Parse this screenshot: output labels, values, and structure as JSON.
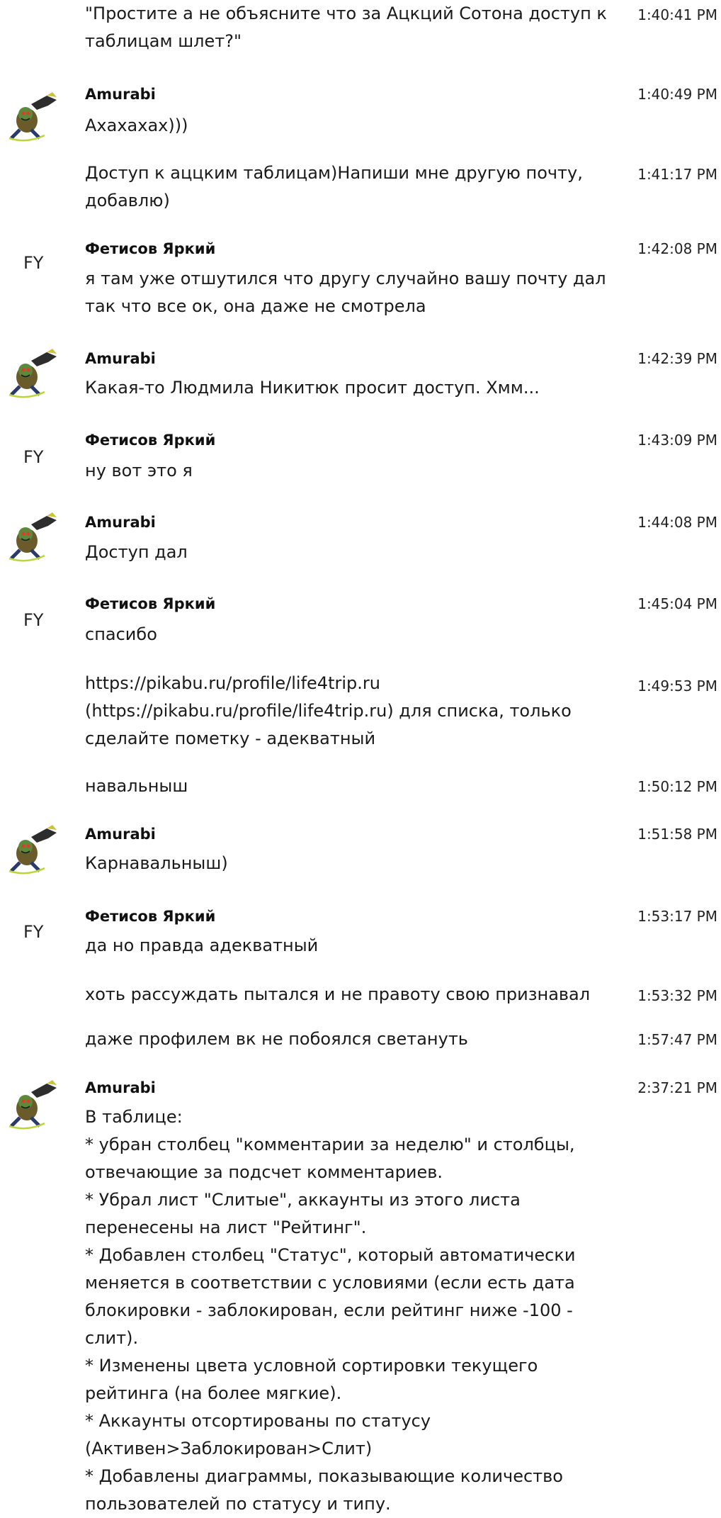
{
  "messages": [
    {
      "kind": "cont",
      "text": "\"Простите а не объясните что за Ацкций Сотона доступ к таблицам шлет?\"",
      "time": "1:40:41 PM"
    },
    {
      "kind": "head",
      "author": "Amurabi",
      "avatar": "goblin-avatar-icon",
      "text": "Ахахахах)))",
      "time": "1:40:49 PM"
    },
    {
      "kind": "cont",
      "text": "Доступ к аццким таблицам)Напиши мне другую почту, добавлю)",
      "time": "1:41:17 PM"
    },
    {
      "kind": "head",
      "author": "Фетисов Яркий",
      "initials": "FY",
      "text": "я там уже отшутился что другу случайно вашу почту дал так что все ок, она даже не смотрела",
      "time": "1:42:08 PM"
    },
    {
      "kind": "head",
      "author": "Amurabi",
      "avatar": "goblin-avatar-icon",
      "text": "Какая-то Людмила Никитюк просит доступ. Хмм...",
      "time": "1:42:39 PM"
    },
    {
      "kind": "head",
      "author": "Фетисов Яркий",
      "initials": "FY",
      "text": "ну вот это я",
      "time": "1:43:09 PM"
    },
    {
      "kind": "head",
      "author": "Amurabi",
      "avatar": "goblin-avatar-icon",
      "text": "Доступ дал",
      "time": "1:44:08 PM"
    },
    {
      "kind": "head",
      "author": "Фетисов Яркий",
      "initials": "FY",
      "text": "спасибо",
      "time": "1:45:04 PM"
    },
    {
      "kind": "cont",
      "text": "https://pikabu.ru/profile/life4trip.ru (https://pikabu.ru/profile/life4trip.ru) для списка, только сделайте пометку - адекватный",
      "time": "1:49:53 PM"
    },
    {
      "kind": "cont",
      "text": "навальныш",
      "time": "1:50:12 PM"
    },
    {
      "kind": "head",
      "author": "Amurabi",
      "avatar": "goblin-avatar-icon",
      "text": "Карнавальныш)",
      "time": "1:51:58 PM"
    },
    {
      "kind": "head",
      "author": "Фетисов Яркий",
      "initials": "FY",
      "text": "да но правда адекватный",
      "time": "1:53:17 PM"
    },
    {
      "kind": "cont",
      "text": "хоть рассуждать пытался и не правоту свою признавал",
      "time": "1:53:32 PM"
    },
    {
      "kind": "cont",
      "text": "даже профилем вк не побоялся светануть",
      "time": "1:57:47 PM"
    },
    {
      "kind": "head",
      "author": "Amurabi",
      "avatar": "goblin-avatar-icon",
      "text": "В таблице:\n* убран столбец \"комментарии за неделю\" и столбцы, отвечающие за подсчет комментариев.\n* Убрал лист \"Слитые\", аккаунты из этого листа перенесены на лист \"Рейтинг\".\n* Добавлен столбец \"Статус\", который автоматически меняется в соответствии с условиями (если есть дата блокировки - заблокирован, если рейтинг ниже -100 - слит).\n* Изменены цвета условной сортировки текущего рейтинга (на более мягкие).\n* Аккаунты отсортированы по статусу (Активен>Заблокирован>Слит)\n* Добавлены диаграммы, показывающие количество пользователей по статусу и типу.",
      "time": "2:37:21 PM"
    }
  ]
}
